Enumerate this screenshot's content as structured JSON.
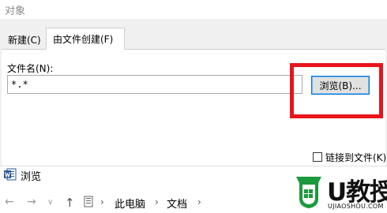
{
  "dialog": {
    "title": "对象"
  },
  "tabs": [
    {
      "label": "新建(C)",
      "active": false
    },
    {
      "label": "由文件创建(F)",
      "active": true
    }
  ],
  "file_section": {
    "label": "文件名(N):",
    "value": "*.*",
    "browse_button": "浏览(B)...",
    "link_checkbox_label": "链接到文件(K)",
    "link_checked": false
  },
  "highlight_color": "#e8141a",
  "browse_window": {
    "title": "浏览",
    "app_icon": "word-icon",
    "breadcrumb": [
      "此电脑",
      "文档"
    ]
  },
  "watermark": {
    "text": "U教授",
    "subtext": "UJIAOSHOU.COM",
    "color": "#1a9a3c"
  }
}
